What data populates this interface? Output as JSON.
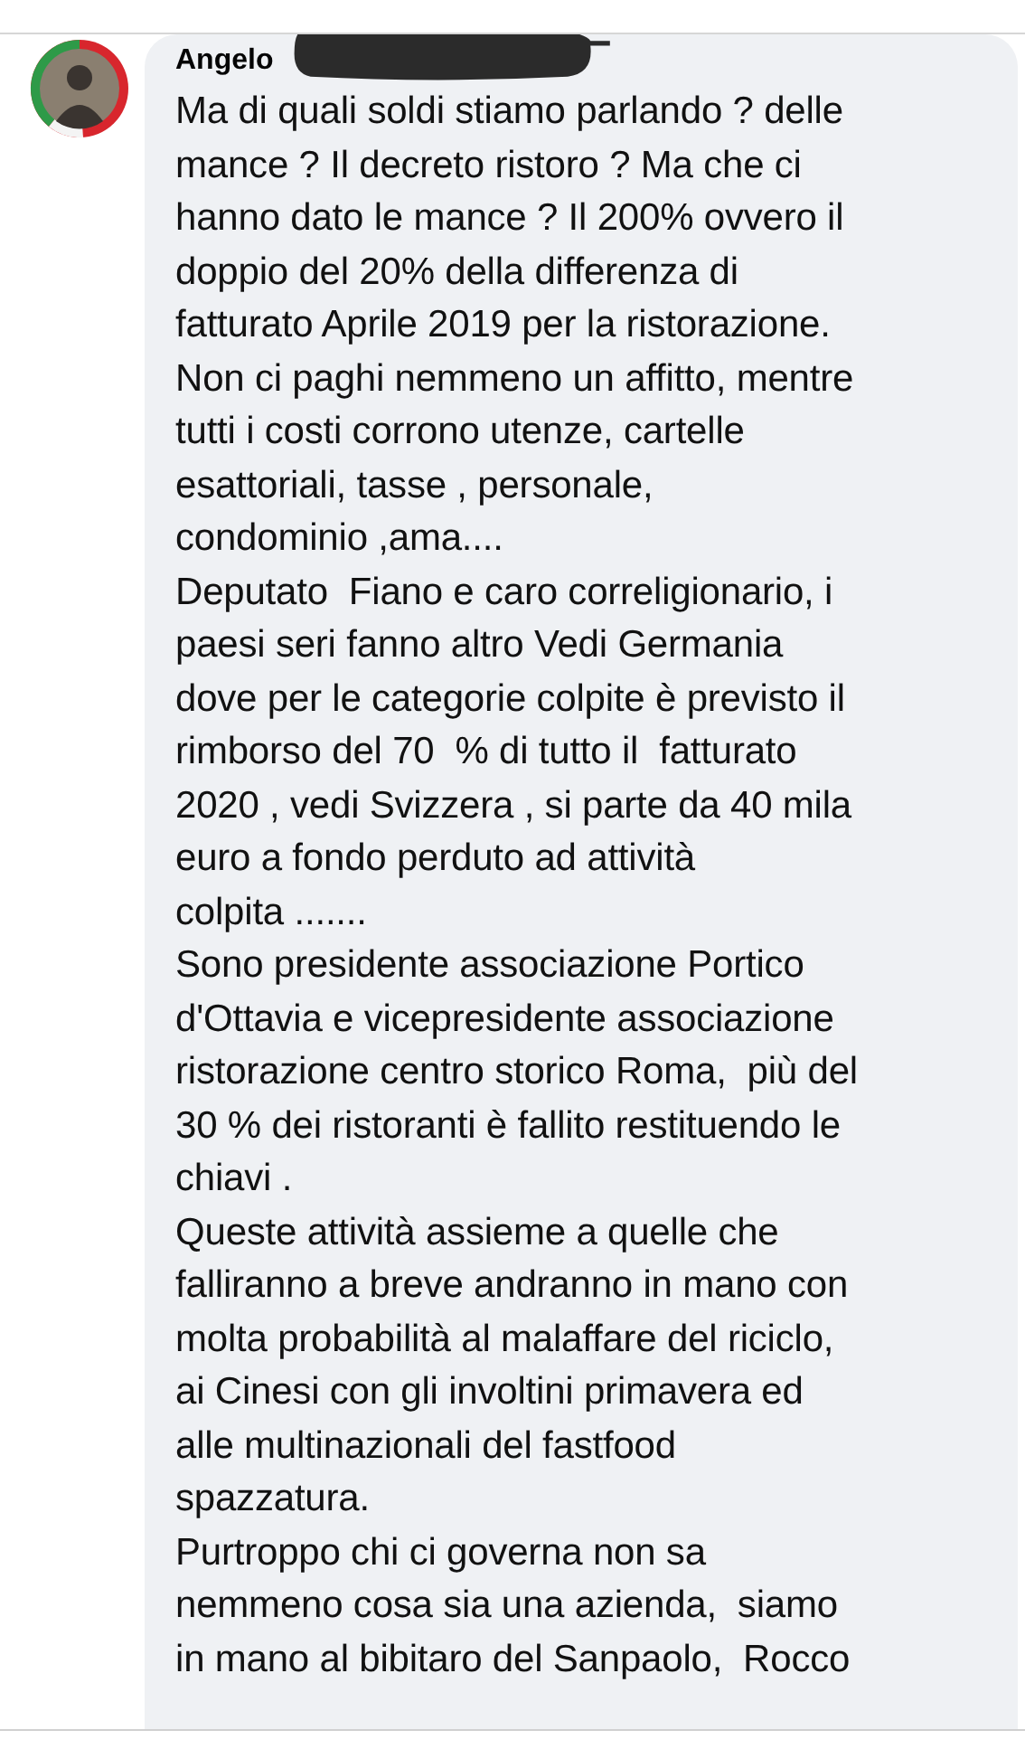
{
  "comment": {
    "author": "Angelo",
    "paragraphs": [
      {
        "lines": [
          "Ma di quali soldi stiamo parlando ? delle",
          "mance ? Il decreto ristoro ? Ma che ci",
          "hanno dato le mance ? Il 200% ovvero il",
          "doppio del 20% della differenza di",
          "fatturato Aprile 2019 per la ristorazione.",
          "Non ci paghi nemmeno un affitto, mentre",
          "tutti i costi corrono utenze, cartelle",
          "esattoriali, tasse , personale,",
          "condominio ,ama...."
        ]
      },
      {
        "lines": [
          "Deputato  Fiano e caro correligionario, i",
          "paesi seri fanno altro Vedi Germania",
          "dove per le categorie colpite è previsto il",
          "rimborso del 70  % di tutto il  fatturato",
          "2020 , vedi Svizzera , si parte da 40 mila",
          "euro a fondo perduto ad attività",
          "colpita ......."
        ]
      },
      {
        "lines": [
          "Sono presidente associazione Portico",
          "d'Ottavia e vicepresidente associazione",
          "ristorazione centro storico Roma,  più del",
          "30 % dei ristoranti è fallito restituendo le",
          "chiavi ."
        ]
      },
      {
        "lines": [
          "Queste attività assieme a quelle che",
          "falliranno a breve andranno in mano con",
          "molta probabilità al malaffare del riciclo,",
          "ai Cinesi con gli involtini primavera ed",
          "alle multinazionali del fastfood",
          "spazzatura."
        ]
      },
      {
        "lines": [
          "Purtroppo chi ci governa non sa",
          "nemmeno cosa sia una azienda,  siamo",
          "in mano al bibitaro del Sanpaolo,  Rocco"
        ]
      }
    ]
  }
}
